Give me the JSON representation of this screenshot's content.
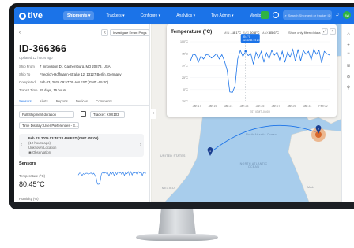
{
  "nav": {
    "logo": "tive",
    "items": [
      "Shipments ▾",
      "Trackers ▾",
      "Configure ▾",
      "Analytics ▾",
      "Tive Admin ▾",
      "Monitoring"
    ],
    "search_placeholder": "Search Shipment or tracker ID",
    "avatar_initials": "AW"
  },
  "shipment": {
    "back": "‹",
    "share_icon": "<",
    "investigate_label": "Investigate Errant Pings",
    "id": "ID-366366",
    "updated": "Updated 12 hours ago",
    "fields": [
      {
        "label": "Ship From",
        "value": "7 Innovation Dr, Gaithersburg, MD 20878, USA"
      },
      {
        "label": "Ship To",
        "value": "Friedrich-Hoffmann-Straße 12, 13127 Berlin, Germany"
      },
      {
        "label": "Completed",
        "value": "Feb 03, 2025 09:57:00 AM EST (GMT -05:00)"
      },
      {
        "label": "Transit Time",
        "value": "15 days, 15 hours"
      }
    ],
    "tabs": [
      "Sensors",
      "Alerts",
      "Reports",
      "Devices",
      "Comments"
    ],
    "duration": "Full Shipment duration",
    "tracker": "Tracker: XXX103",
    "time_display": "Time Display: User Preferences - E...",
    "event": {
      "time": "Feb 03, 2025 03:49:23 AM EST (GMT -05:00)",
      "ago": "(12 hours ago)",
      "location": "Unknown Location",
      "source": "Observation"
    },
    "sensors_title": "Sensors",
    "temp_label": "Temperature (°C)",
    "temp_value": "80.45°C",
    "humidity_label": "Humidity (%)"
  },
  "temperature": {
    "title": "Temperature (°C)",
    "min": {
      "label": "MIN",
      "value": "-18.1°C"
    },
    "avg": {
      "label": "AVG",
      "value": "60.8°C"
    },
    "max": {
      "label": "MAX",
      "value": "85.6°C"
    },
    "toggle": "Show only filtered data",
    "tooltip_line1": "39.4°C",
    "tooltip_line2": "Jan 12 11:13 am"
  },
  "chart_data": {
    "type": "line",
    "title": "Temperature (°C)",
    "xlabel": "",
    "ylabel": "",
    "y_ticks": [
      "100°C",
      "75°C",
      "50°C",
      "25°C",
      "0°C",
      "-25°C"
    ],
    "ylim": [
      -25,
      100
    ],
    "x_ticks": [
      "Jan 17",
      "Jan 19",
      "Jan 21",
      "Jan 23",
      "Jan 25",
      "Jan 27",
      "Jan 29",
      "Jan 31",
      "Feb 02"
    ],
    "axis_caption": "EST (GMT -05:00)",
    "series": [
      {
        "values": [
          60,
          74,
          72,
          57,
          70,
          64,
          73,
          72,
          66,
          70,
          75,
          64,
          73,
          59,
          40,
          -5,
          -6,
          8,
          64,
          82,
          69,
          80,
          71,
          75,
          53,
          78,
          66,
          80,
          57,
          77,
          64,
          82,
          72,
          79,
          62,
          80,
          57,
          78,
          68,
          84,
          59,
          84,
          60,
          82,
          74,
          80,
          62,
          84,
          74,
          82,
          56,
          80,
          75,
          72
        ]
      }
    ],
    "highlight_index": 21,
    "color": "#1b73e8"
  },
  "map": {
    "labels": [
      "Baffin Bay",
      "Greenland Sea",
      "Hudson Bay",
      "UNITED STATES",
      "NORTH ATLANTIC OCEAN",
      "North Atlantic Ocean",
      "MEXICO",
      "MALI"
    ],
    "origin_marker": "1",
    "dest_marker": "2",
    "collapse": "‹",
    "tools": [
      "⌂",
      "+",
      "−",
      "≋",
      "⊙",
      "⚲"
    ]
  }
}
